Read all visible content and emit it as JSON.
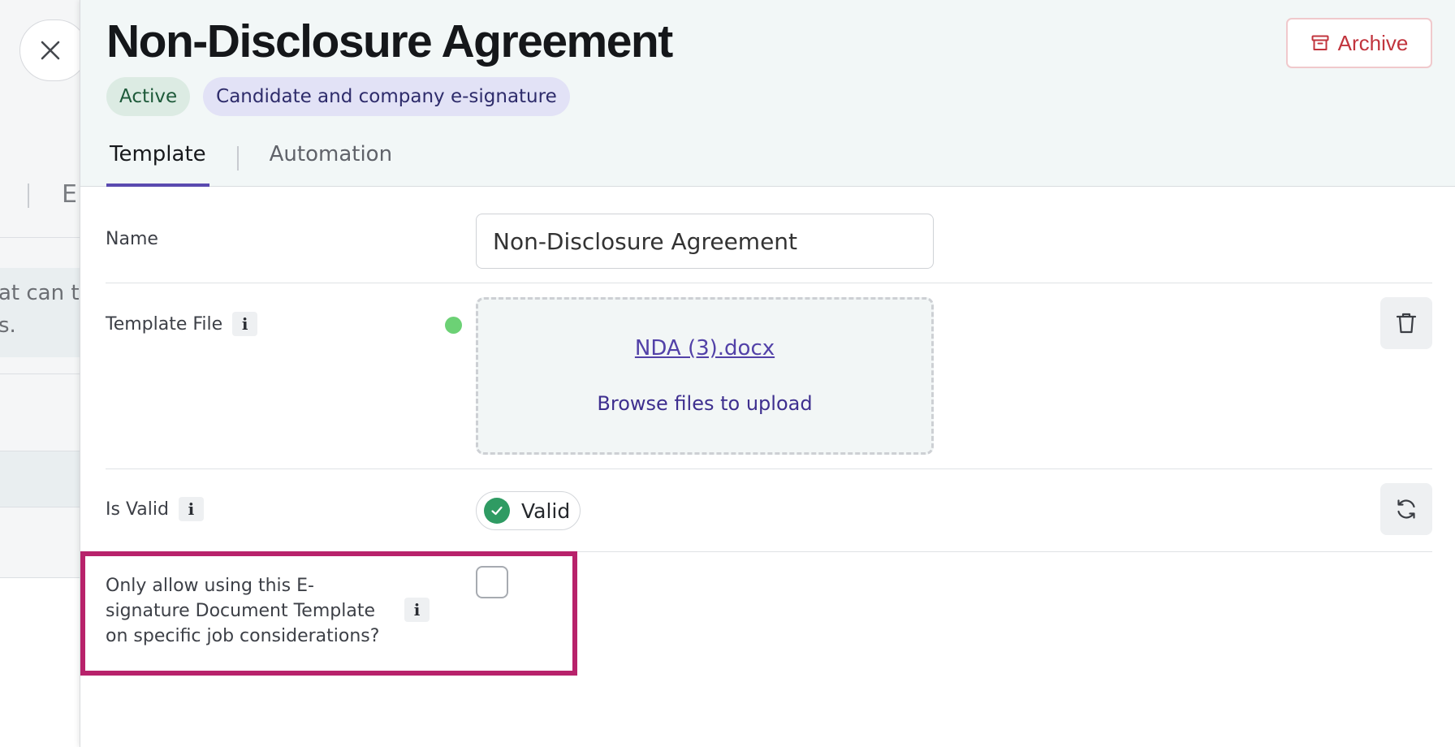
{
  "background": {
    "tab_letter": "E",
    "callout_line_1": "at can th",
    "callout_line_2": "s."
  },
  "close_icon": "close-icon",
  "header": {
    "title": "Non-Disclosure Agreement",
    "badges": {
      "status": "Active",
      "signature_type": "Candidate and company e-signature"
    },
    "archive_label": "Archive",
    "archive_icon": "archive-box-icon"
  },
  "tabs": {
    "template": "Template",
    "automation": "Automation",
    "active": "Template"
  },
  "form": {
    "name": {
      "label": "Name",
      "value": "Non-Disclosure Agreement"
    },
    "template_file": {
      "label": "Template File",
      "file_name": "NDA (3).docx",
      "browse_text": "Browse files to upload",
      "status_color": "#6cd175"
    },
    "is_valid": {
      "label": "Is Valid",
      "value": "Valid"
    },
    "restrict": {
      "label": "Only allow using this E-signature Document Template on specific job considerations?",
      "checked": false
    },
    "info_glyph": "i"
  },
  "colors": {
    "accent": "#5a4ab0",
    "archive_red": "#c1343d",
    "highlight": "#b8226b",
    "valid_green": "#2f9b63"
  }
}
